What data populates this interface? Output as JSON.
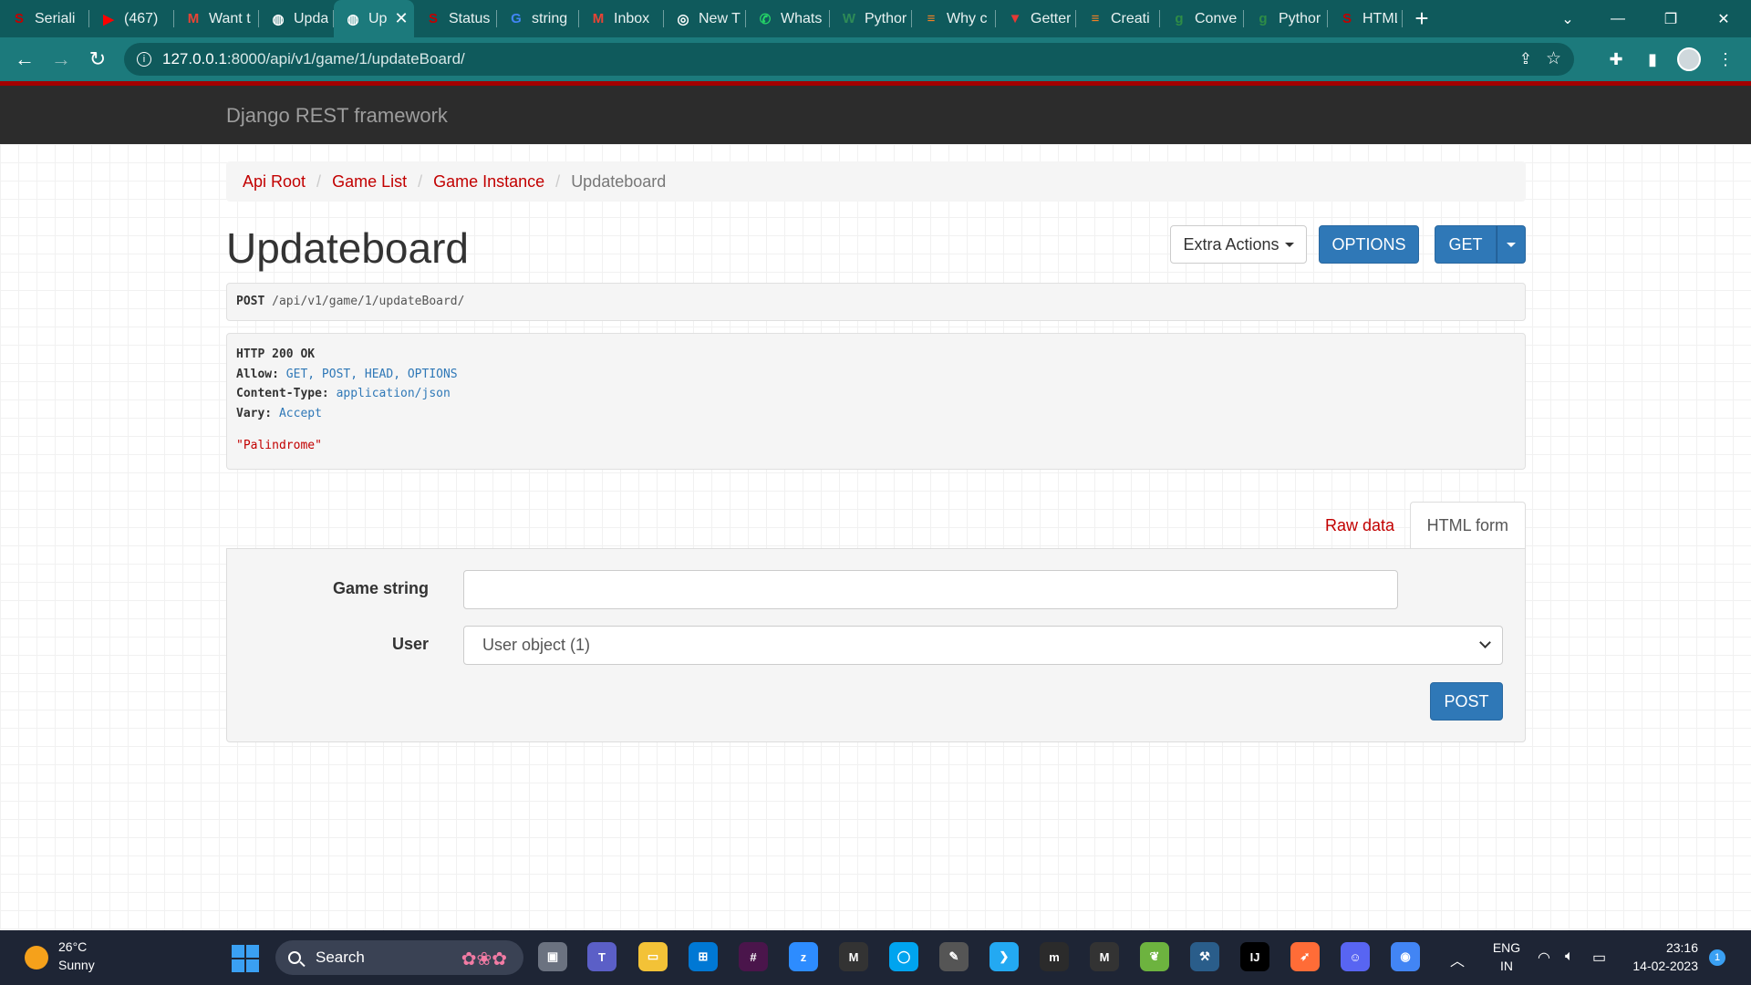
{
  "browser": {
    "tabs": [
      {
        "title": "Seriali",
        "favicon_color": "#c20000",
        "favicon_glyph": "S",
        "icon": "drf-icon"
      },
      {
        "title": "(467)",
        "favicon_color": "#ff0000",
        "favicon_glyph": "▶",
        "icon": "youtube-icon"
      },
      {
        "title": "Want t",
        "favicon_color": "#ea4335",
        "favicon_glyph": "M",
        "icon": "gmail-icon"
      },
      {
        "title": "Updat",
        "favicon_color": "#ffffff",
        "favicon_glyph": "◍",
        "icon": "globe-icon"
      },
      {
        "title": "Up",
        "favicon_color": "#ffffff",
        "favicon_glyph": "◍",
        "icon": "globe-icon",
        "active": true
      },
      {
        "title": "Status",
        "favicon_color": "#c20000",
        "favicon_glyph": "S",
        "icon": "drf-icon"
      },
      {
        "title": "string",
        "favicon_color": "#4285f4",
        "favicon_glyph": "G",
        "icon": "google-icon"
      },
      {
        "title": "Inbox",
        "favicon_color": "#ea4335",
        "favicon_glyph": "M",
        "icon": "gmail-icon"
      },
      {
        "title": "New T",
        "favicon_color": "#ffffff",
        "favicon_glyph": "◎",
        "icon": "chrome-icon"
      },
      {
        "title": "Whats",
        "favicon_color": "#25d366",
        "favicon_glyph": "✆",
        "icon": "whatsapp-icon"
      },
      {
        "title": "Pythor",
        "favicon_color": "#2e8b57",
        "favicon_glyph": "W",
        "icon": "w3schools-icon"
      },
      {
        "title": "Why c",
        "favicon_color": "#f48024",
        "favicon_glyph": "≡",
        "icon": "stackoverflow-icon"
      },
      {
        "title": "Getter",
        "favicon_color": "#e53935",
        "favicon_glyph": "▼",
        "icon": "tutorial-icon"
      },
      {
        "title": "Creati",
        "favicon_color": "#f48024",
        "favicon_glyph": "≡",
        "icon": "stackoverflow-icon"
      },
      {
        "title": "Conve",
        "favicon_color": "#2f8d46",
        "favicon_glyph": "ɡ",
        "icon": "geeksforgeeks-icon"
      },
      {
        "title": "Pythor",
        "favicon_color": "#2f8d46",
        "favicon_glyph": "ɡ",
        "icon": "geeksforgeeks-icon"
      },
      {
        "title": "HTML",
        "favicon_color": "#c20000",
        "favicon_glyph": "S",
        "icon": "drf-icon"
      }
    ],
    "url_host": "127.0.0.1",
    "url_path": ":8000/api/v1/game/1/updateBoard/"
  },
  "app": {
    "brand": "Django REST framework"
  },
  "breadcrumb": {
    "items": [
      "Api Root",
      "Game List",
      "Game Instance"
    ],
    "current": "Updateboard"
  },
  "page": {
    "title": "Updateboard",
    "buttons": {
      "extra_actions": "Extra Actions",
      "options": "OPTIONS",
      "get": "GET"
    }
  },
  "request": {
    "method": "POST",
    "path": "/api/v1/game/1/updateBoard/"
  },
  "response": {
    "status": "HTTP 200 OK",
    "headers": [
      {
        "key": "Allow:",
        "value": "GET, POST, HEAD, OPTIONS"
      },
      {
        "key": "Content-Type:",
        "value": "application/json"
      },
      {
        "key": "Vary:",
        "value": "Accept"
      }
    ],
    "body": "\"Palindrome\""
  },
  "content_tabs": {
    "raw": "Raw data",
    "html": "HTML form"
  },
  "form": {
    "fields": [
      {
        "label": "Game string",
        "type": "text",
        "value": ""
      },
      {
        "label": "User",
        "type": "select",
        "value": "User object (1)"
      }
    ],
    "submit": "POST"
  },
  "taskbar": {
    "weather_temp": "26°C",
    "weather_cond": "Sunny",
    "search_placeholder": "Search",
    "language": "ENG",
    "region": "IN",
    "time": "23:16",
    "date": "14-02-2023",
    "notification_count": "1",
    "apps": [
      {
        "name": "task-view-icon",
        "color": "#6b7280",
        "glyph": "▣"
      },
      {
        "name": "teams-icon",
        "color": "#5b5fc7",
        "glyph": "T"
      },
      {
        "name": "file-explorer-icon",
        "color": "#f3c237",
        "glyph": "▭"
      },
      {
        "name": "store-icon",
        "color": "#0078d4",
        "glyph": "⊞"
      },
      {
        "name": "slack-icon",
        "color": "#4a154b",
        "glyph": "#"
      },
      {
        "name": "zoom-icon",
        "color": "#2d8cff",
        "glyph": "z"
      },
      {
        "name": "medium-icon",
        "color": "#333333",
        "glyph": "M"
      },
      {
        "name": "cortana-icon",
        "color": "#00a4ef",
        "glyph": "◯"
      },
      {
        "name": "whiteboard-icon",
        "color": "#555555",
        "glyph": "✎"
      },
      {
        "name": "vscode-icon",
        "color": "#23a9f2",
        "glyph": "❯"
      },
      {
        "name": "miro-icon",
        "color": "#2b2b2b",
        "glyph": "m"
      },
      {
        "name": "medium-dark-icon",
        "color": "#333333",
        "glyph": "M"
      },
      {
        "name": "spring-icon",
        "color": "#6db33f",
        "glyph": "❦"
      },
      {
        "name": "mysql-workbench-icon",
        "color": "#2a5d8a",
        "glyph": "⚒"
      },
      {
        "name": "intellij-icon",
        "color": "#000000",
        "glyph": "IJ"
      },
      {
        "name": "postman-icon",
        "color": "#ff6c37",
        "glyph": "➶"
      },
      {
        "name": "discord-icon",
        "color": "#5865f2",
        "glyph": "☺"
      },
      {
        "name": "chrome-taskbar-icon",
        "color": "#4285f4",
        "glyph": "◉"
      }
    ]
  }
}
